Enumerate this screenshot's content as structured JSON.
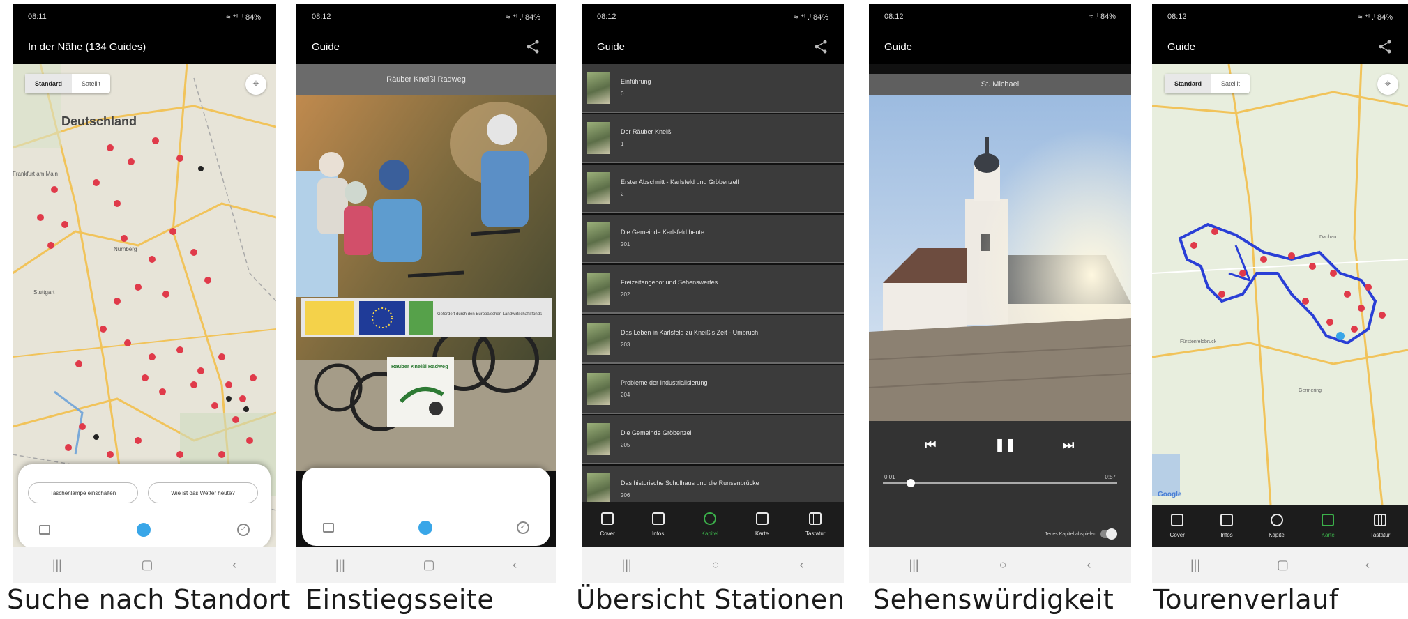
{
  "captions": [
    "Suche nach Standort",
    "Einstiegsseite",
    "Übersicht Stationen",
    "Sehenswürdigkeit",
    "Tourenverlauf"
  ],
  "status": {
    "p1_time": "08:11",
    "p1_right": "≈ ⁺ᴵ .ᴵ 84%",
    "p2_time": "08:12",
    "p2_right": "≈ ⁺ᴵ .ᴵ 84%",
    "p3_time": "08:12",
    "p3_right": "≈ ⁺ᴵ .ᴵ 84%",
    "p4_time": "08:12",
    "p4_right": "≈ .ᴵ 84%",
    "p5_time": "08:12",
    "p5_right": "≈ ⁺ᴵ .ᴵ 84%"
  },
  "screen1": {
    "title": "In der Nähe (134 Guides)",
    "map_toggle": [
      "Standard",
      "Satellit"
    ],
    "map_label_country": "Deutschland",
    "map_labels": [
      "Frankfurt am Main",
      "Nürnberg",
      "Stuttgart"
    ],
    "chips": [
      "Taschenlampe einschalten",
      "Wie ist das Wetter heute?"
    ]
  },
  "screen2": {
    "title": "Guide",
    "banner": "Räuber Kneißl Radweg",
    "logo_caption": "Räuber Kneißl Radweg",
    "leader_text": "Gefördert durch den Europäischen Landwirtschaftsfonds"
  },
  "screen3": {
    "title": "Guide",
    "items": [
      {
        "title": "Einführung",
        "num": "0"
      },
      {
        "title": "Der Räuber Kneißl",
        "num": "1"
      },
      {
        "title": "Erster Abschnitt - Karlsfeld und Gröbenzell",
        "num": "2"
      },
      {
        "title": "Die Gemeinde Karlsfeld heute",
        "num": "201"
      },
      {
        "title": "Freizeitangebot und Sehenswertes",
        "num": "202"
      },
      {
        "title": "Das Leben in Karlsfeld zu Kneißls Zeit - Umbruch",
        "num": "203"
      },
      {
        "title": "Probleme der Industrialisierung",
        "num": "204"
      },
      {
        "title": "Die Gemeinde Gröbenzell",
        "num": "205"
      },
      {
        "title": "Das historische Schulhaus und die Runsenbrücke",
        "num": "206"
      }
    ],
    "tabs": [
      "Cover",
      "Infos",
      "Kapitel",
      "Karte",
      "Tastatur"
    ]
  },
  "screen4": {
    "title": "Guide",
    "banner": "St. Michael",
    "time_left": "0:01",
    "time_right": "0:57",
    "autoplay": "Jedes Kapitel abspielen",
    "progress": 0.12
  },
  "screen5": {
    "title": "Guide",
    "map_toggle": [
      "Standard",
      "Satellit"
    ],
    "tabs": [
      "Cover",
      "Infos",
      "Kapitel",
      "Karte",
      "Tastatur"
    ],
    "google": "Google",
    "place_labels": [
      "Fürstenfeldbruck",
      "Dachau",
      "Germering"
    ]
  },
  "colors": {
    "accent_green": "#3bb04a",
    "route_blue": "#2a3fd6",
    "marker_red": "#e03a4a",
    "blue_dot": "#39a6e8"
  }
}
